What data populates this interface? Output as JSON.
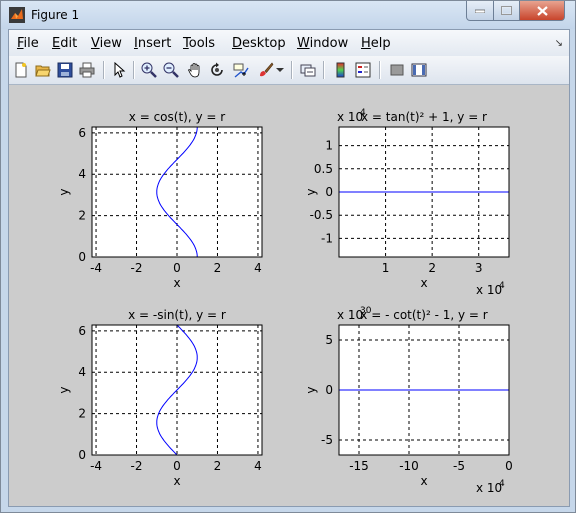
{
  "window": {
    "title": "Figure 1"
  },
  "menu": [
    "File",
    "Edit",
    "View",
    "Insert",
    "Tools",
    "Desktop",
    "Window",
    "Help"
  ],
  "menu_mnemonic": [
    "F",
    "E",
    "V",
    "I",
    "T",
    "D",
    "W",
    "H"
  ],
  "toolbar_icons": [
    "new-figure-icon",
    "open-file-icon",
    "save-icon",
    "print-icon",
    "edit-plot-icon",
    "zoom-in-icon",
    "zoom-out-icon",
    "pan-icon",
    "rotate-3d-icon",
    "data-cursor-icon",
    "brush-icon",
    "brush-dropdown-icon",
    "link-plot-icon",
    "colorbar-icon",
    "legend-icon",
    "hide-plot-tools-icon",
    "show-plot-tools-icon"
  ],
  "chart_data": [
    {
      "type": "line",
      "title": "x = cos(t), y = r",
      "xlabel": "x",
      "ylabel": "y",
      "xlim": [
        -4.2,
        4.2
      ],
      "ylim": [
        0,
        6.283
      ],
      "xticks": [
        -4,
        -2,
        0,
        2,
        4
      ],
      "xtick_labels": [
        "-4",
        "-2",
        "0",
        "2",
        "4"
      ],
      "yticks": [
        0,
        2,
        4,
        6
      ],
      "ytick_labels": [
        "0",
        "2",
        "4",
        "6"
      ],
      "grid": true,
      "series": [
        {
          "x": [
            1,
            0.866,
            0.5,
            0,
            -0.5,
            -0.866,
            -1,
            -0.866,
            -0.5,
            0,
            0.5,
            0.866,
            1
          ],
          "y": [
            0,
            0.524,
            1.047,
            1.571,
            2.094,
            2.618,
            3.142,
            3.665,
            4.189,
            4.712,
            5.236,
            5.76,
            6.283
          ],
          "color": "#0000ff"
        }
      ]
    },
    {
      "type": "line",
      "title": "x = tan(t)² + 1, y = r",
      "title_superscript": "2",
      "xlabel": "x",
      "ylabel": "y",
      "xlim": [
        1,
        36500
      ],
      "ylim": [
        -14000,
        14000
      ],
      "xticks": [
        10000,
        20000,
        30000
      ],
      "xtick_labels": [
        "1",
        "2",
        "3"
      ],
      "x_exponent": "x 10",
      "x_exponent_power": "4",
      "yticks": [
        -10000,
        -5000,
        0,
        5000,
        10000
      ],
      "ytick_labels": [
        "-1",
        "-0.5",
        "0",
        "0.5",
        "1"
      ],
      "y_exponent": "x 10",
      "y_exponent_power": "4",
      "grid": true,
      "series": [
        {
          "x": [
            1,
            36500
          ],
          "y": [
            0,
            0
          ],
          "color": "#0000ff"
        }
      ]
    },
    {
      "type": "line",
      "title": "x = -sin(t), y = r",
      "xlabel": "x",
      "ylabel": "y",
      "xlim": [
        -4.2,
        4.2
      ],
      "ylim": [
        0,
        6.283
      ],
      "xticks": [
        -4,
        -2,
        0,
        2,
        4
      ],
      "xtick_labels": [
        "-4",
        "-2",
        "0",
        "2",
        "4"
      ],
      "yticks": [
        0,
        2,
        4,
        6
      ],
      "ytick_labels": [
        "0",
        "2",
        "4",
        "6"
      ],
      "grid": true,
      "series": [
        {
          "x": [
            0,
            -0.5,
            -0.866,
            -1,
            -0.866,
            -0.5,
            0,
            0.5,
            0.866,
            1,
            0.866,
            0.5,
            0
          ],
          "y": [
            0,
            0.524,
            1.047,
            1.571,
            2.094,
            2.618,
            3.142,
            3.665,
            4.189,
            4.712,
            5.236,
            5.76,
            6.283
          ],
          "color": "#0000ff"
        }
      ]
    },
    {
      "type": "line",
      "title": "x = - cot(t)² - 1, y = r",
      "xlabel": "x",
      "ylabel": "y",
      "xlim": [
        -17,
        0
      ],
      "ylim": [
        -6.5,
        6.5
      ],
      "xticks": [
        -15,
        -10,
        -5,
        0
      ],
      "xtick_labels": [
        "-15",
        "-10",
        "-5",
        "0"
      ],
      "x_exponent": "x 10",
      "x_exponent_power": "4",
      "yticks": [
        -5,
        0,
        5
      ],
      "ytick_labels": [
        "-5",
        "0",
        "5"
      ],
      "y_exponent": "x 10",
      "y_exponent_power": "30",
      "grid": true,
      "series": [
        {
          "x": [
            -17,
            0
          ],
          "y": [
            0,
            0
          ],
          "color": "#0000ff"
        }
      ]
    }
  ]
}
